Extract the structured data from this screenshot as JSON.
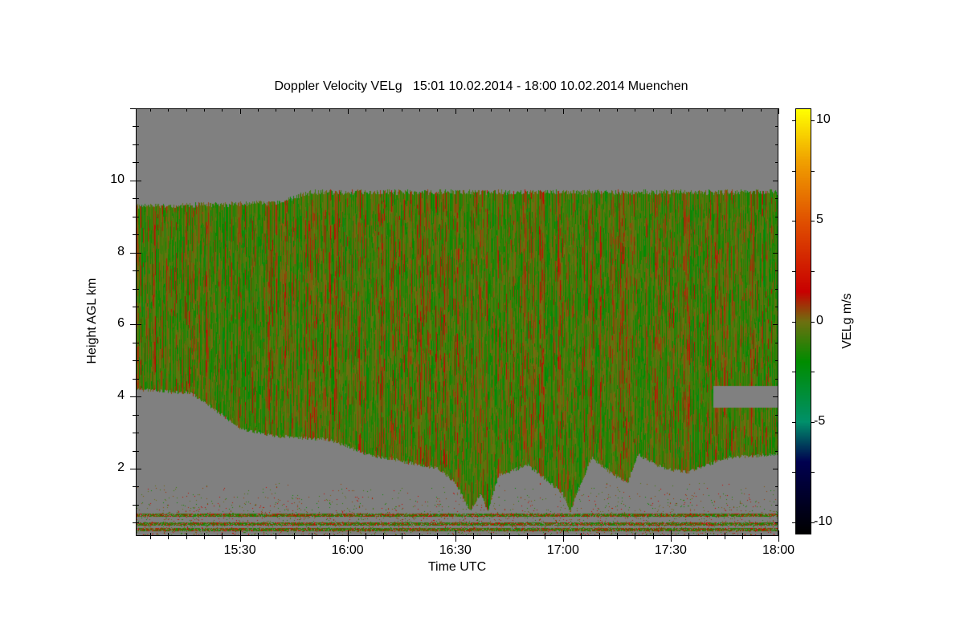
{
  "chart_data": {
    "type": "heatmap",
    "title": "Doppler Velocity VELg   15:01 10.02.2014 - 18:00 10.02.2014 Muenchen",
    "xlabel": "Time UTC",
    "ylabel": "Height AGL km",
    "colorbar_label": "VELg m/s",
    "x_range_minutes": [
      901,
      1080
    ],
    "x_ticks": [
      {
        "min": 930,
        "label": "15:30"
      },
      {
        "min": 960,
        "label": "16:00"
      },
      {
        "min": 990,
        "label": "16:30"
      },
      {
        "min": 1020,
        "label": "17:00"
      },
      {
        "min": 1050,
        "label": "17:30"
      },
      {
        "min": 1080,
        "label": "18:00"
      }
    ],
    "y_range_km": [
      0.13,
      12
    ],
    "y_ticks": [
      {
        "v": 2,
        "label": "2"
      },
      {
        "v": 4,
        "label": "4"
      },
      {
        "v": 6,
        "label": "6"
      },
      {
        "v": 8,
        "label": "8"
      },
      {
        "v": 10,
        "label": "10"
      }
    ],
    "z_range": [
      -10.6,
      10.6
    ],
    "colorbar_ticks": [
      {
        "v": 10,
        "label": "10"
      },
      {
        "v": 5,
        "label": "5"
      },
      {
        "v": 0,
        "label": "0"
      },
      {
        "v": -5,
        "label": "-5"
      },
      {
        "v": -10,
        "label": "-10"
      }
    ],
    "no_data_color": "#808080",
    "colormap": [
      [
        -10.6,
        "#000000"
      ],
      [
        -7,
        "#000050"
      ],
      [
        -5,
        "#00906a"
      ],
      [
        -2,
        "#008c00"
      ],
      [
        0,
        "#6e7010"
      ],
      [
        1.5,
        "#c80000"
      ],
      [
        5,
        "#e05000"
      ],
      [
        8,
        "#f0a000"
      ],
      [
        10.6,
        "#ffff00"
      ]
    ],
    "cloud_top_km": [
      [
        901,
        9.3
      ],
      [
        940,
        9.4
      ],
      [
        950,
        9.7
      ],
      [
        1080,
        9.7
      ]
    ],
    "cloud_base_km": [
      [
        901,
        4.2
      ],
      [
        916,
        4.1
      ],
      [
        922,
        3.7
      ],
      [
        930,
        3.1
      ],
      [
        940,
        2.9
      ],
      [
        955,
        2.8
      ],
      [
        965,
        2.4
      ],
      [
        975,
        2.2
      ],
      [
        985,
        2.0
      ],
      [
        990,
        1.6
      ],
      [
        994,
        0.8
      ],
      [
        997,
        1.3
      ],
      [
        999,
        0.8
      ],
      [
        1002,
        1.8
      ],
      [
        1010,
        2.1
      ],
      [
        1015,
        1.7
      ],
      [
        1020,
        1.3
      ],
      [
        1022,
        0.8
      ],
      [
        1025,
        1.6
      ],
      [
        1028,
        2.3
      ],
      [
        1033,
        1.9
      ],
      [
        1038,
        1.6
      ],
      [
        1041,
        2.4
      ],
      [
        1048,
        2.0
      ],
      [
        1055,
        1.9
      ],
      [
        1060,
        2.1
      ],
      [
        1066,
        2.3
      ],
      [
        1080,
        2.4
      ]
    ],
    "gap_layer_km": {
      "from_min": 1062,
      "to_min": 1080,
      "bottom": 3.7,
      "top": 4.3
    },
    "mean_velocity_ms": -0.6,
    "near_surface_layers_km": [
      0.7,
      0.45,
      0.3
    ]
  }
}
